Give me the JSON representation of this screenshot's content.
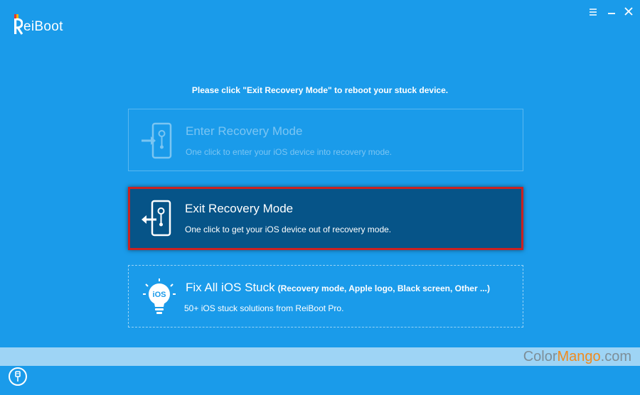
{
  "app": {
    "logo_letter": "R",
    "logo_text": "eiBoot"
  },
  "window_controls": {
    "minimize_icon": "minimize-icon",
    "close_icon": "close-icon"
  },
  "instruction": "Please click \"Exit Recovery Mode\" to reboot your stuck device.",
  "options": {
    "enter": {
      "title": "Enter Recovery Mode",
      "desc": "One click to enter your iOS device into recovery mode.",
      "icon": "phone-enter-icon",
      "state": "disabled"
    },
    "exit": {
      "title": "Exit Recovery Mode",
      "desc": "One click to get your iOS device out of recovery mode.",
      "icon": "phone-exit-icon",
      "state": "selected"
    },
    "fix": {
      "title": "Fix All iOS Stuck",
      "subtitle": "(Recovery mode, Apple logo, Black screen, Other ...)",
      "desc": "50+ iOS stuck solutions from ReiBoot Pro.",
      "icon": "ios-bulb-icon",
      "icon_label": "iOS"
    }
  },
  "watermark": {
    "part1": "Color",
    "part2": "Mango",
    "part3": ".com"
  },
  "colors": {
    "background": "#1a9bea",
    "selected_card": "#065488",
    "selected_border": "#c92222",
    "logo_red": "#e8362c",
    "logo_yellow": "#f5b400",
    "watermark_accent": "#ef8a1e"
  }
}
